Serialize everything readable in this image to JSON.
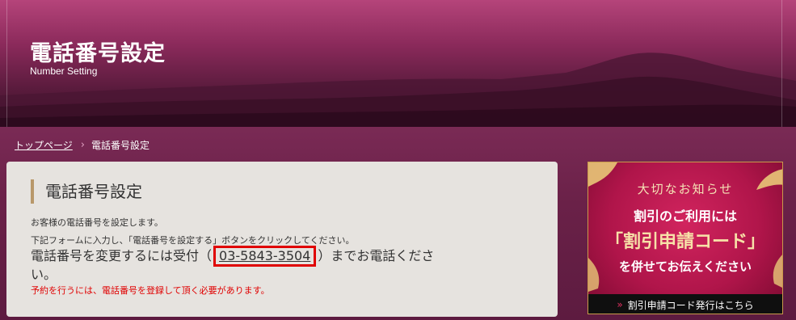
{
  "banner": {
    "title": "電話番号設定",
    "subtitle": "Number Setting"
  },
  "breadcrumb": {
    "home": "トップページ",
    "separator": "›",
    "current": "電話番号設定"
  },
  "panel": {
    "heading": "電話番号設定",
    "line1": "お客様の電話番号を設定します。",
    "line2": "下記フォームに入力し、「電話番号を設定する」ボタンをクリックしてください。",
    "large_prefix": "電話番号を変更するには受付（",
    "phone": "03-5843-3504",
    "large_suffix": "）までお電話ください。",
    "warning": "予約を行うには、電話番号を登録して頂く必要があります。"
  },
  "side_banner": {
    "notice": "大切なお知らせ",
    "line2": "割引のご利用には",
    "line3": "「割引申請コード」",
    "line4": "を併せてお伝えください",
    "button_arrow": "»",
    "button_label": "割引申請コード発行はこちら"
  },
  "colors": {
    "accent_red": "#e00000",
    "heading_bar": "#b8986a",
    "banner_pink": "#b5447a",
    "side_crimson": "#b0154a"
  }
}
